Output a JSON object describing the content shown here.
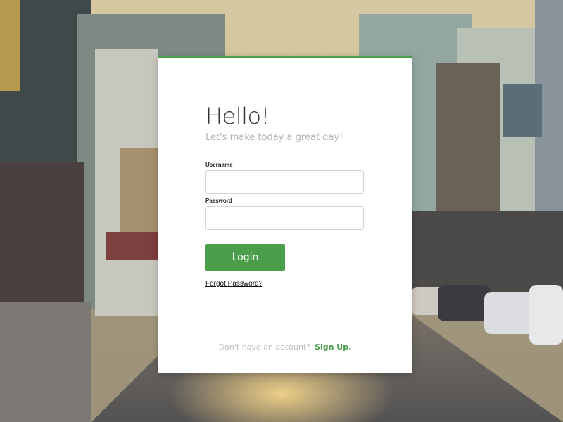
{
  "login": {
    "title": "Hello!",
    "subtitle": "Let's make today a great day!",
    "username_label": "Username",
    "username_value": "",
    "password_label": "Password",
    "password_value": "",
    "login_button": "Login",
    "forgot_password": "Forgot Password?",
    "footer_text": "Don't have an account?",
    "signup_link": "Sign Up."
  },
  "colors": {
    "accent": "#4a9e4a",
    "card_background": "#ffffff",
    "subtitle_text": "#b4b4b4"
  }
}
